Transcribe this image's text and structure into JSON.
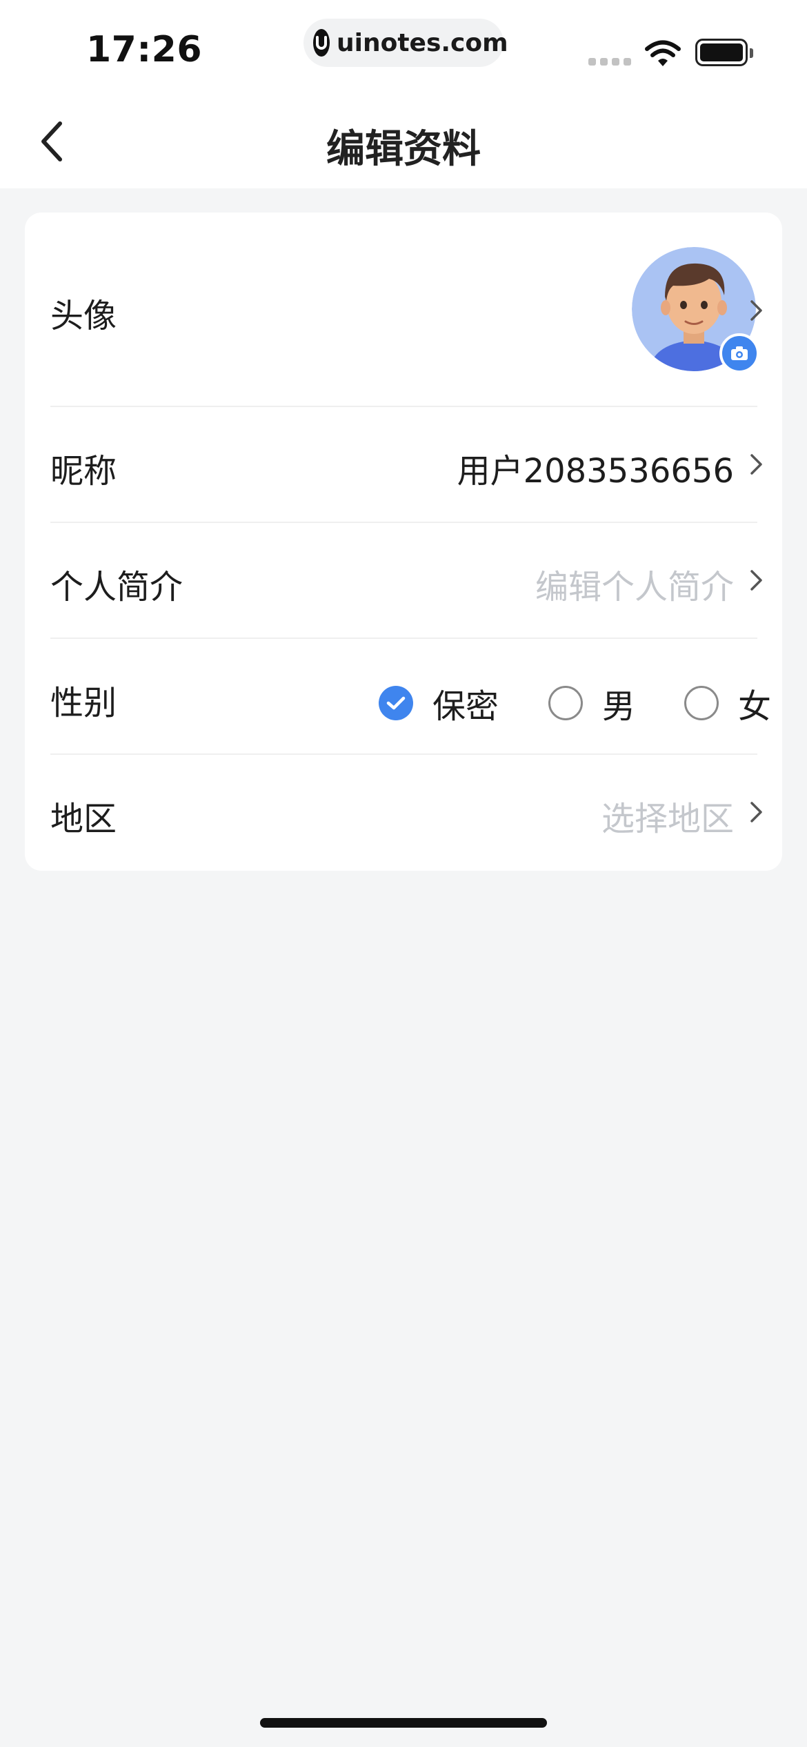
{
  "status_bar": {
    "time": "17:26",
    "url": "uinotes.com"
  },
  "nav": {
    "title": "编辑资料",
    "back_icon": "chevron-left-icon"
  },
  "profile": {
    "avatar_label": "头像",
    "nickname_label": "昵称",
    "nickname_value": "用户2083536656",
    "bio_label": "个人简介",
    "bio_placeholder": "编辑个人简介",
    "gender_label": "性别",
    "gender_options": [
      "保密",
      "男",
      "女"
    ],
    "gender_selected": "保密",
    "region_label": "地区",
    "region_placeholder": "选择地区"
  },
  "colors": {
    "accent": "#3f85ee",
    "background": "#f4f5f6",
    "card": "#ffffff",
    "placeholder": "#c4c7cc"
  }
}
